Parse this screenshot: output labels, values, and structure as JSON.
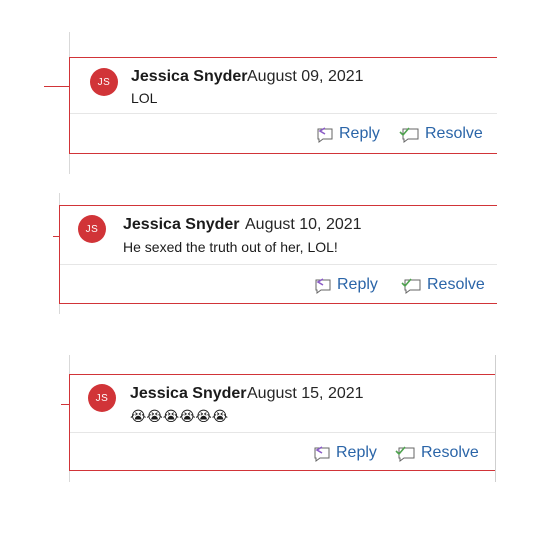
{
  "comments": [
    {
      "initials": "JS",
      "author": "Jessica Snyder",
      "date": "August 09, 2021",
      "text": "LOL",
      "reply_label": "Reply",
      "resolve_label": "Resolve"
    },
    {
      "initials": "JS",
      "author": "Jessica Snyder",
      "date": "August 10, 2021",
      "text": "He sexed the truth out of her, LOL!",
      "reply_label": "Reply",
      "resolve_label": "Resolve"
    },
    {
      "initials": "JS",
      "author": "Jessica Snyder",
      "date": "August 15, 2021",
      "text": "😭😭😭😭😭😭",
      "reply_label": "Reply",
      "resolve_label": "Resolve"
    }
  ],
  "colors": {
    "accent_red": "#d13438",
    "link_blue": "#2b65a8",
    "reply_purple": "#8a5cc6",
    "resolve_green": "#4ea34e"
  },
  "icons": {
    "reply": "reply-icon",
    "resolve": "resolve-icon"
  }
}
